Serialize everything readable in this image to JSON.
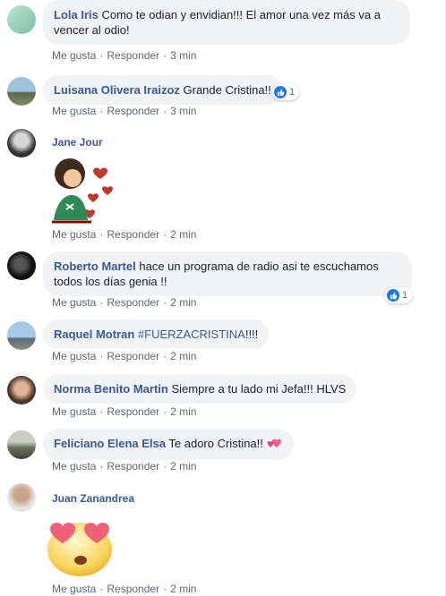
{
  "actions": {
    "like": "Me gusta",
    "reply": "Responder",
    "sep": "·"
  },
  "comments": [
    {
      "name": "Lola Iris",
      "text": "Como te odian y envidian!!! El amor una vez más va a vencer al odio!",
      "time": "3 min"
    },
    {
      "name": "Luisana Olivera Iraizoz",
      "text": "Grande Cristina!!",
      "time": "3 min",
      "reactions": "1"
    },
    {
      "name": "Jane Jour",
      "time": "2 min",
      "sticker": "girl-with-hearts-sticker"
    },
    {
      "name": "Roberto Martel",
      "text": "hace un programa de radio asi te escuchamos todos los días genia !!",
      "time": "2 min",
      "reactions": "1"
    },
    {
      "name": "Raquel Motran",
      "hashtag": "#FUERZACRISTINA",
      "text": "!!!!",
      "time": "2 min"
    },
    {
      "name": "Norma Benito Martin",
      "text": "Siempre a tu lado mi Jefa!!! HLVS",
      "time": "2 min"
    },
    {
      "name": "Feliciano Elena Elsa",
      "text": "Te adoro Cristina!!",
      "time": "2 min",
      "emoji": "two-hearts-icon"
    },
    {
      "name": "Juan Zanandrea",
      "time": "2 min",
      "sticker": "heart-eyes-emoji"
    }
  ],
  "colors": {
    "name": "#385898",
    "bubble": "#f2f3f5",
    "like": "#1877f2",
    "meta": "#606770"
  }
}
